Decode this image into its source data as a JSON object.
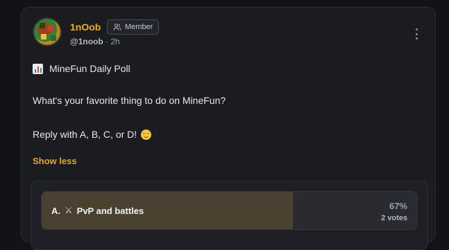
{
  "post": {
    "author": {
      "username": "1nOob",
      "role_badge": "Member",
      "handle": "@1noob",
      "time_ago": "· 2h"
    },
    "lines": {
      "title": "MineFun Daily Poll",
      "question": "What's your favorite thing to do on MineFun?",
      "instruction": "Reply with A, B, C, or D!"
    },
    "show_less_label": "Show less",
    "icons": {
      "title_icon": "bar-chart-icon",
      "instruction_icon": "smiling-face-icon",
      "option_icon": "crossed-swords-icon",
      "badge_icon": "users-icon",
      "menu_icon": "more-vertical-icon"
    }
  },
  "poll": {
    "options": [
      {
        "letter": "A.",
        "text": "PvP and battles",
        "percent_label": "67%",
        "percent": 67,
        "votes_label": "2 votes"
      }
    ]
  },
  "colors": {
    "username": "#f2b01e",
    "accent_link": "#e2a72b",
    "poll_fill": "#4a4130",
    "card_bg": "#1b1c20"
  }
}
